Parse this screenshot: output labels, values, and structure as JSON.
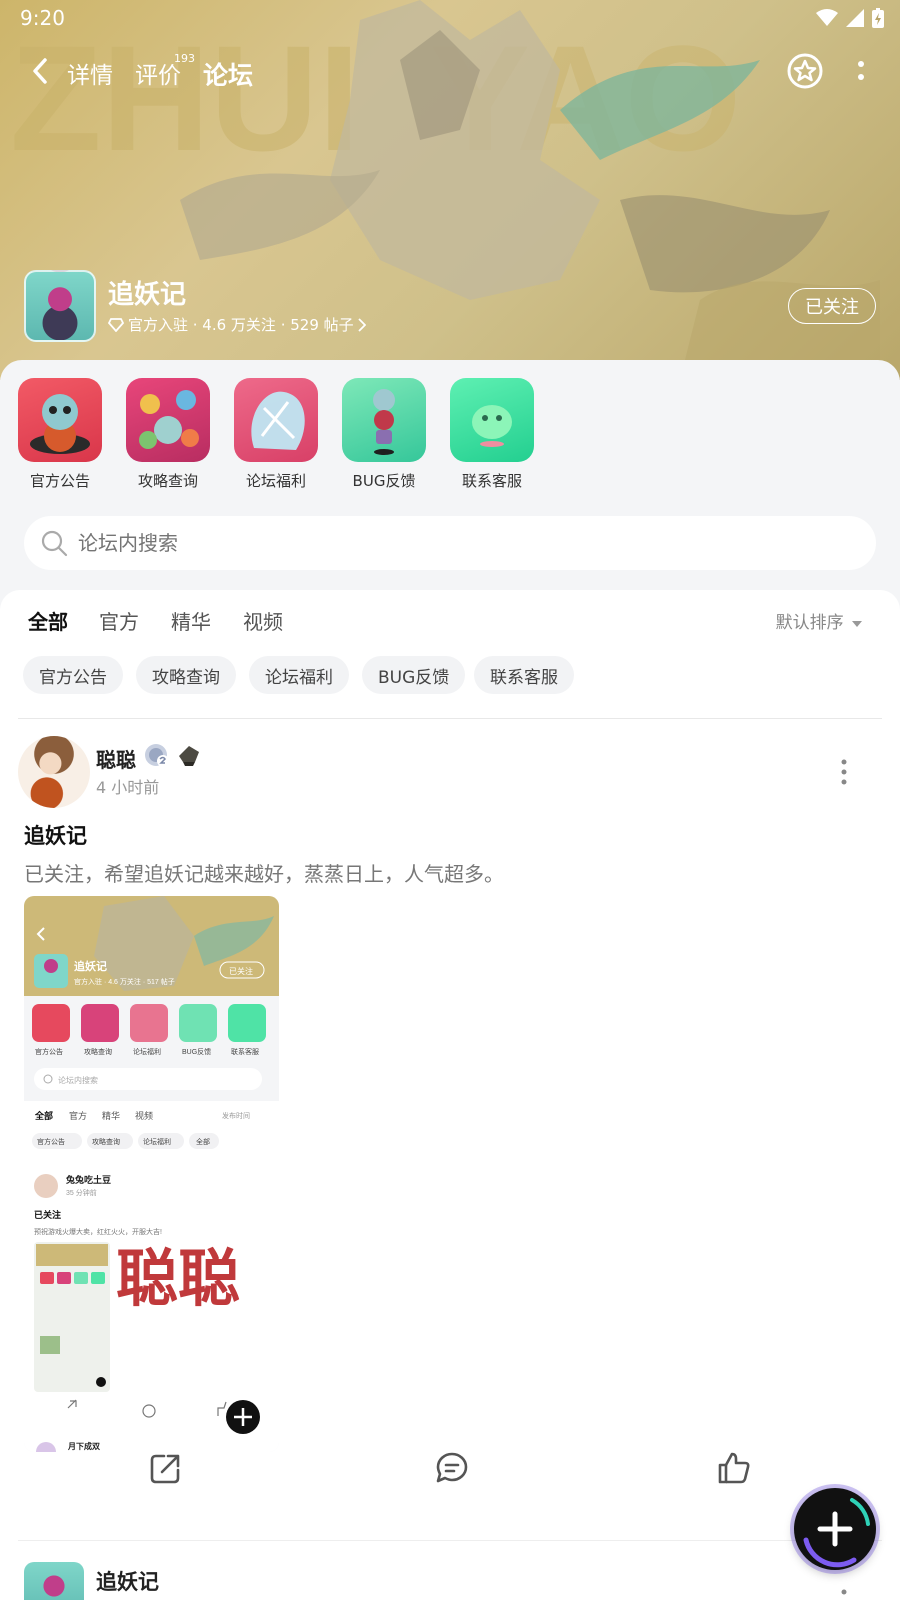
{
  "status_bar": {
    "time": "9:20"
  },
  "nav": {
    "tabs": [
      {
        "label": "详情"
      },
      {
        "label": "评价",
        "badge": "193"
      },
      {
        "label": "论坛"
      }
    ],
    "active_tab": "论坛"
  },
  "app": {
    "name": "追妖记",
    "meta": "官方入驻 · 4.6 万关注 · 529 帖子",
    "follow_label": "已关注"
  },
  "quick_links": [
    {
      "label": "官方公告"
    },
    {
      "label": "攻略查询"
    },
    {
      "label": "论坛福利"
    },
    {
      "label": "BUG反馈"
    },
    {
      "label": "联系客服"
    }
  ],
  "search": {
    "placeholder": "论坛内搜索"
  },
  "feed": {
    "tabs": [
      "全部",
      "官方",
      "精华",
      "视频"
    ],
    "active_tab": "全部",
    "sort_label": "默认排序",
    "chips": [
      "官方公告",
      "攻略查询",
      "论坛福利",
      "BUG反馈",
      "联系客服"
    ]
  },
  "post": {
    "author": "聪聪",
    "time": "4 小时前",
    "title": "追妖记",
    "body": "已关注，希望追妖记越来越好，蒸蒸日上，人气超多。",
    "image": {
      "app_name": "追妖记",
      "follow_label": "已关注",
      "meta": "官方入驻 · 4.6 万关注 · 517 帖子",
      "quick_labels": [
        "官方公告",
        "攻略查询",
        "论坛福利",
        "BUG反馈",
        "联系客服"
      ],
      "search_placeholder": "论坛内搜索",
      "tabs": [
        "全部",
        "官方",
        "精华",
        "视频"
      ],
      "sort_label": "发布时间",
      "chips": [
        "官方公告",
        "攻略查询",
        "论坛福利",
        "全部"
      ],
      "inner_author": "兔兔吃土豆",
      "inner_time": "35 分钟前",
      "inner_title": "已关注",
      "inner_body": "预祝游戏火爆大卖，红红火火，开服大吉!",
      "overlay_text": "聪聪",
      "next_author": "月下成双"
    }
  },
  "next_post": {
    "author": "追妖记"
  },
  "colors": {
    "accent": "#2fd2b8",
    "banner": "#d4c085",
    "overlay_text": "#c0393b"
  },
  "icons": [
    "back-icon",
    "star-icon",
    "more-icon",
    "diamond-icon",
    "chevron-right-icon",
    "search-icon",
    "share-icon",
    "comment-icon",
    "like-icon",
    "plus-icon"
  ]
}
